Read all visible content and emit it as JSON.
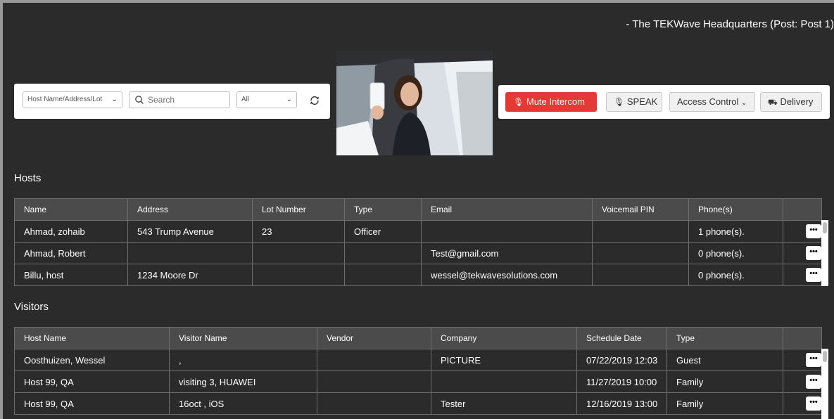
{
  "header": {
    "title": "- The TEKWave Headquarters (Post: Post 1)"
  },
  "search": {
    "filter_selected": "Host Name/Address/Lot",
    "search_placeholder": "Search",
    "status_selected": "All"
  },
  "actions": {
    "mute": "Mute Intercom",
    "speak": "SPEAK",
    "access_control": "Access Control",
    "delivery": "Delivery"
  },
  "hosts": {
    "title": "Hosts",
    "columns": [
      "Name",
      "Address",
      "Lot Number",
      "Type",
      "Email",
      "Voicemail PIN",
      "Phone(s)"
    ],
    "rows": [
      [
        "Ahmad, zohaib",
        "543 Trump Avenue",
        "23",
        "Officer",
        "",
        "",
        "1 phone(s)."
      ],
      [
        "Ahmad, Robert",
        "",
        "",
        "",
        "Test@gmail.com",
        "",
        "0 phone(s)."
      ],
      [
        "Billu, host",
        "1234 Moore Dr",
        "",
        "",
        "wessel@tekwavesolutions.com",
        "",
        "0 phone(s)."
      ]
    ]
  },
  "visitors": {
    "title": "Visitors",
    "columns": [
      "Host Name",
      "Visitor Name",
      "Vendor",
      "Company",
      "Schedule Date",
      "Type"
    ],
    "rows": [
      [
        "Oosthuizen, Wessel",
        ",",
        "",
        "PICTURE",
        "07/22/2019 12:03",
        "Guest"
      ],
      [
        "Host 99, QA",
        "visiting 3, HUAWEI",
        "",
        "",
        "11/27/2019 10:00",
        "Family"
      ],
      [
        "Host 99, QA",
        "16oct , iOS",
        "",
        "Tester",
        "12/16/2019 13:00",
        "Family"
      ]
    ]
  },
  "row_action_label": "•••",
  "colors": {
    "background": "#2b2b2b",
    "header_row": "#4b4b4b",
    "mute_red": "#e53935"
  }
}
